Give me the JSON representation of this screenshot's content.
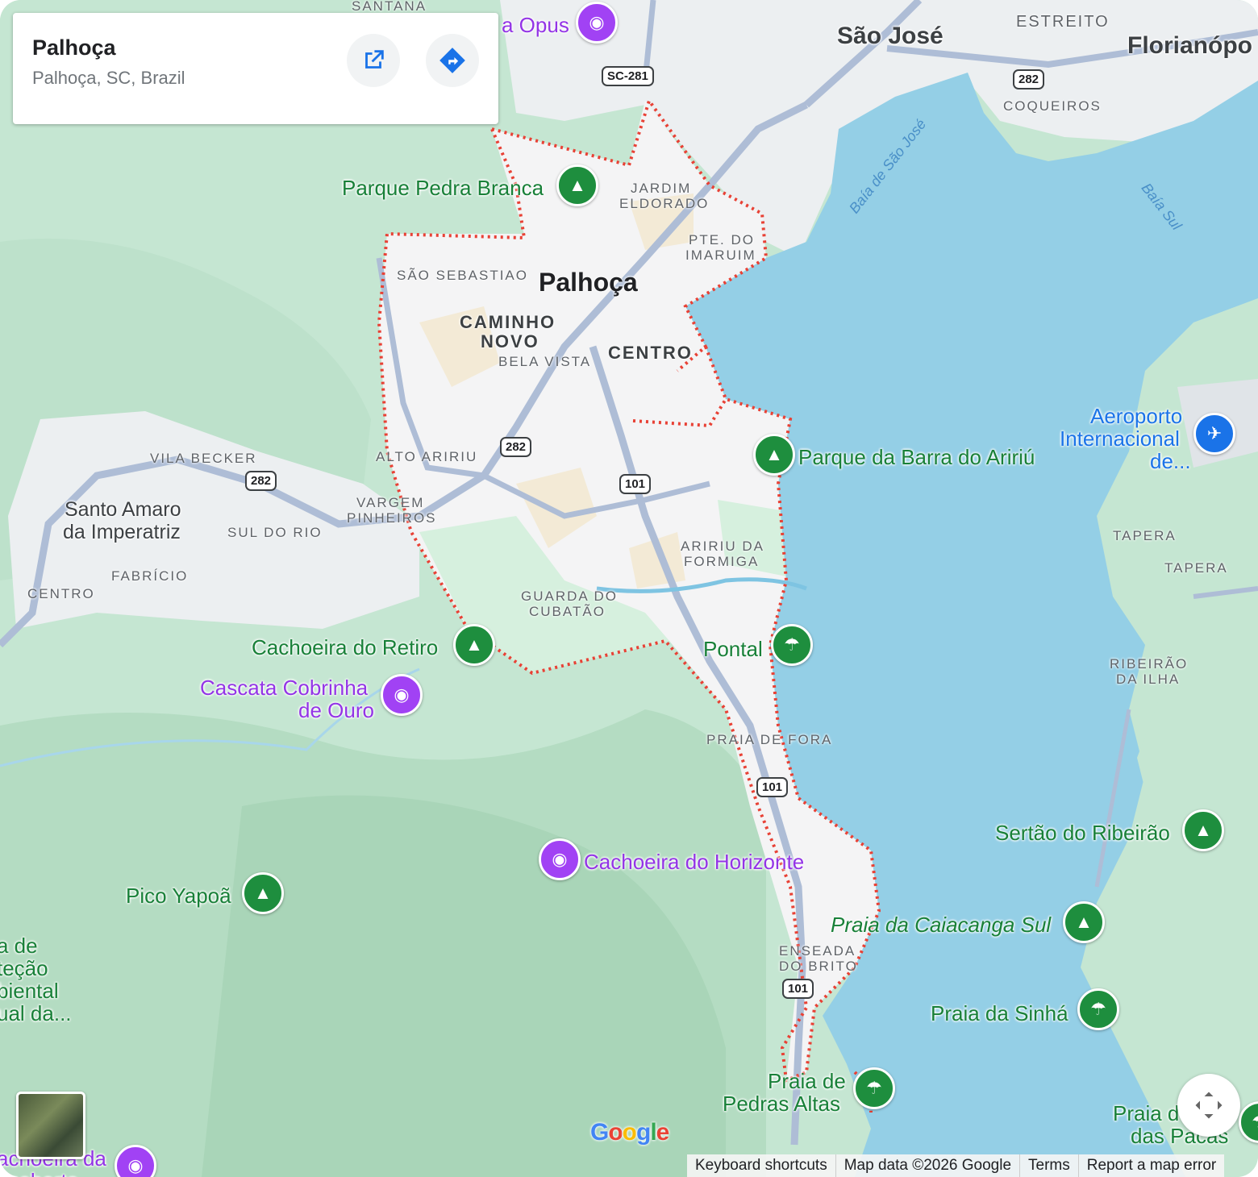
{
  "card": {
    "title": "Palhoça",
    "subtitle": "Palhoça, SC, Brazil"
  },
  "major_labels": {
    "main_city": "Palhoça",
    "sao_jose": "São José",
    "florianopolis": "Florianópo",
    "santo_amaro_1": "Santo Amaro",
    "santo_amaro_2": "da Imperatriz"
  },
  "neighborhoods": {
    "santana": "SANTANA",
    "estreito": "ESTREITO",
    "coqueiros": "COQUEIROS",
    "jardim_1": "JARDIM",
    "jardim_2": "ELDORADO",
    "pte_1": "PTE. DO",
    "pte_2": "IMARUIM",
    "sao_sebastiao": "SÃO SEBASTIAO",
    "caminho_1": "CAMINHO",
    "caminho_2": "NOVO",
    "bela_vista": "BELA VISTA",
    "centro": "CENTRO",
    "alto_aririu": "ALTO ARIRIU",
    "vargem_1": "VARGEM",
    "vargem_2": "PINHEIROS",
    "vila_becker": "VILA BECKER",
    "sul_do_rio": "SUL DO RIO",
    "fabricio": "FABRÍCIO",
    "centro_w": "CENTRO",
    "aririu_1": "ARIRIU DA",
    "aririu_2": "FORMIGA",
    "guarda_1": "GUARDA DO",
    "guarda_2": "CUBATÃO",
    "praia_de_fora": "PRAIA DE FORA",
    "enseada_1": "ENSEADA",
    "enseada_2": "DO BRITO",
    "tapera_1": "TAPERA",
    "tapera_2": "TAPERA",
    "ribeirao_1": "RIBEIRÃO",
    "ribeirao_2": "DA ILHA"
  },
  "water_labels": {
    "baia_sao_jose": "Baía de São José",
    "baia_sul": "Baía Sul"
  },
  "pois": {
    "opus": "a Opus",
    "pedra_branca": "Parque Pedra Branca",
    "barra_aririu": "Parque da Barra do Aririú",
    "aeroporto_1": "Aeroporto",
    "aeroporto_2": "Internacional",
    "aeroporto_3": "de...",
    "cachoeira_retiro": "Cachoeira do Retiro",
    "cascata_1": "Cascata Cobrinha",
    "cascata_2": "de Ouro",
    "pontal": "Pontal",
    "cachoeira_horizonte": "Cachoeira do Horizonte",
    "pico_yapoa": "Pico Yapoã",
    "sertao": "Sertão do Ribeirão",
    "caiacanga": "Praia da Caiacanga Sul",
    "sinha": "Praia da Sinhá",
    "pedras_1": "Praia de",
    "pedras_2": "Pedras Altas",
    "pacas_1": "Praia d",
    "pacas_2": "das Pacas",
    "area_1": "a de",
    "area_2": "teção",
    "area_3": "biental",
    "area_4": "ual da...",
    "cachoeira_bl_1": "achoeira da",
    "cachoeira_bl_2": "acoborto"
  },
  "shields": {
    "sc281": "SC-281",
    "r282_a": "282",
    "r282_b": "282",
    "r282_c": "282",
    "r101_a": "101",
    "r101_b": "101",
    "r101_c": "101"
  },
  "footer": {
    "shortcuts": "Keyboard shortcuts",
    "map_data": "Map data ©2026 Google",
    "terms": "Terms",
    "report": "Report a map error"
  },
  "google_logo": "Google",
  "colors": {
    "land_green": "#c2e8d0",
    "urban": "#f1f3f4",
    "water": "#90d0e8",
    "boundary": "#e84135",
    "road": "#a8b8d0"
  }
}
